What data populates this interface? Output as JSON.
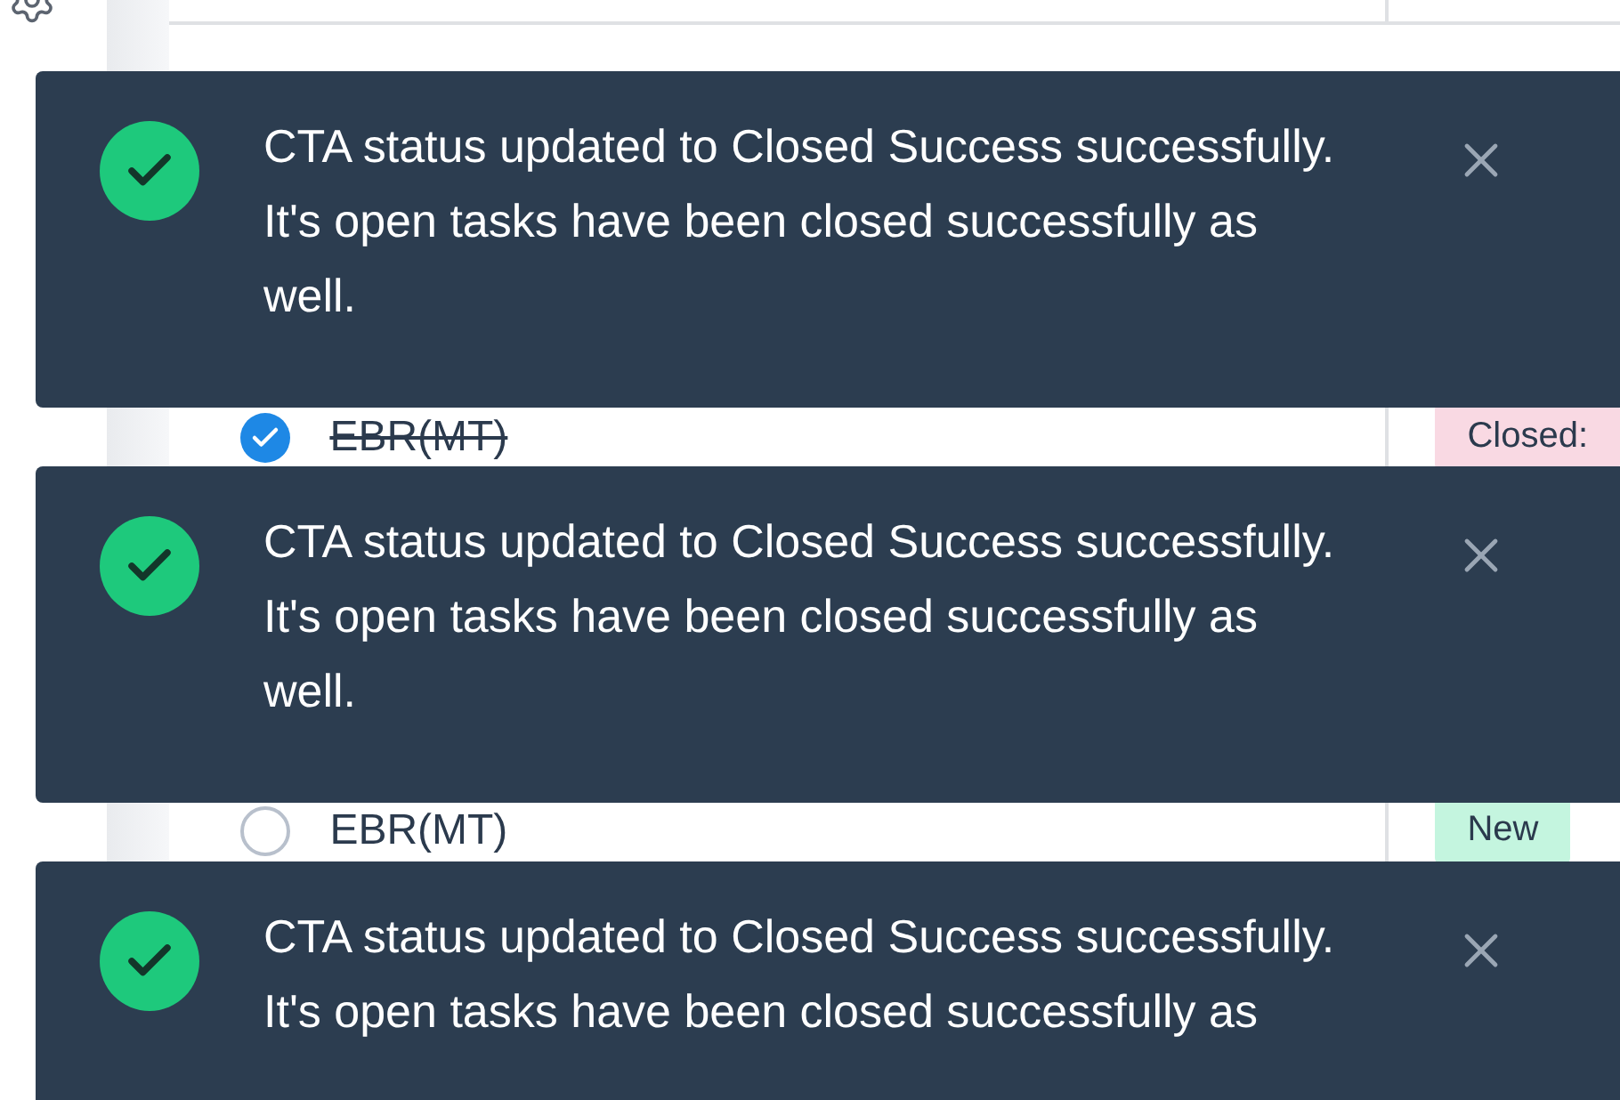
{
  "notifications": [
    {
      "message": "CTA status updated to Closed Success successfully. It's open tasks have been closed successfully as well."
    },
    {
      "message": "CTA status updated to Closed Success successfully. It's open tasks have been closed successfully as well."
    },
    {
      "message": "CTA status updated to Closed Success successfully. It's open tasks have been closed successfully as"
    }
  ],
  "tasks": [
    {
      "name": "EBR(MT)",
      "checked": true,
      "status": "Closed:",
      "color": "#f9d9e3"
    },
    {
      "name": "EBR(MT)",
      "checked": false,
      "status": "New",
      "color": "#c4f5df"
    }
  ]
}
